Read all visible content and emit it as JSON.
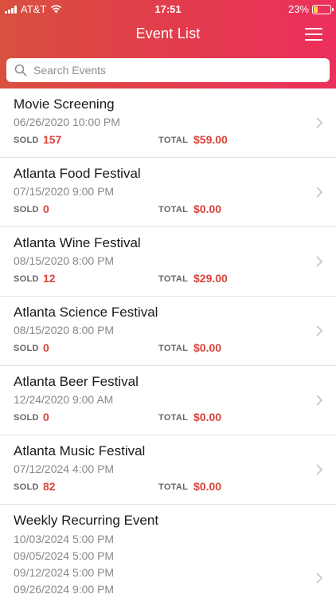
{
  "status_bar": {
    "carrier": "AT&T",
    "time": "17:51",
    "battery": "23%",
    "battery_level": 0.23
  },
  "nav": {
    "title": "Event List",
    "menu_icon": "hamburger-menu-icon"
  },
  "search": {
    "placeholder": "Search Events",
    "value": ""
  },
  "labels": {
    "sold": "SOLD",
    "total": "TOTAL"
  },
  "colors": {
    "header_start": "#d9503f",
    "header_end": "#ec2f5c",
    "accent": "#d8433b"
  },
  "events": [
    {
      "name": "Movie Screening",
      "date": "06/26/2020 10:00 PM",
      "sold": "157",
      "total": "$59.00"
    },
    {
      "name": "Atlanta Food Festival",
      "date": "07/15/2020 9:00 PM",
      "sold": "0",
      "total": "$0.00"
    },
    {
      "name": "Atlanta Wine Festival",
      "date": "08/15/2020 8:00 PM",
      "sold": "12",
      "total": "$29.00"
    },
    {
      "name": "Atlanta Science Festival",
      "date": "08/15/2020 8:00 PM",
      "sold": "0",
      "total": "$0.00"
    },
    {
      "name": "Atlanta Beer Festival",
      "date": "12/24/2020 9:00 AM",
      "sold": "0",
      "total": "$0.00"
    },
    {
      "name": "Atlanta Music Festival",
      "date": "07/12/2024 4:00 PM",
      "sold": "82",
      "total": "$0.00"
    }
  ],
  "recurring_event": {
    "name": "Weekly Recurring Event",
    "dates": [
      "10/03/2024 5:00 PM",
      "09/05/2024 5:00 PM",
      "09/12/2024 5:00 PM",
      "09/26/2024 9:00 PM"
    ]
  }
}
